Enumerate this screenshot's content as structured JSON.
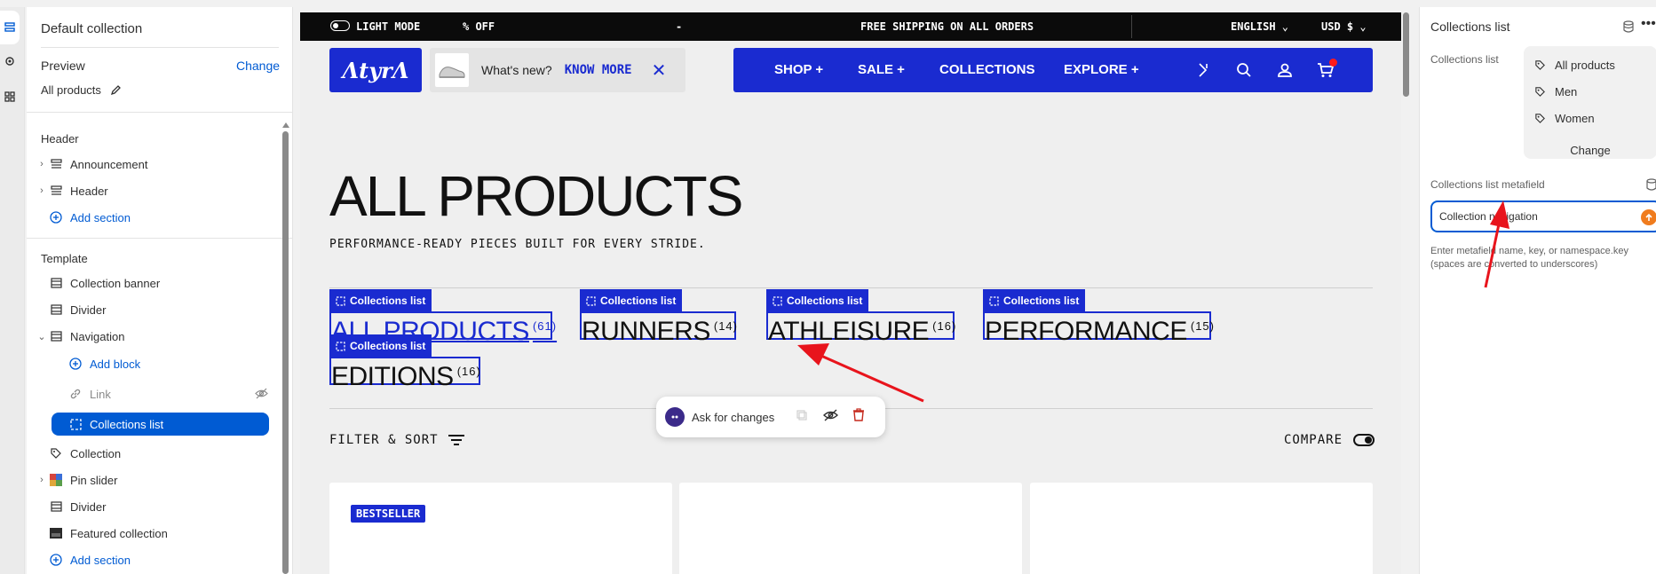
{
  "left_panel": {
    "title": "Default collection",
    "preview_label": "Preview",
    "preview_change": "Change",
    "preview_value": "All products",
    "header_label": "Header",
    "header_items": [
      "Announcement",
      "Header"
    ],
    "add_section": "Add section",
    "template_label": "Template",
    "template_items": {
      "collection_banner": "Collection banner",
      "divider_1": "Divider",
      "navigation": "Navigation",
      "add_block": "Add block",
      "link": "Link",
      "collections_list": "Collections list",
      "collection": "Collection",
      "pin_slider": "Pin slider",
      "divider_2": "Divider",
      "featured_collection": "Featured collection",
      "add_section": "Add section"
    }
  },
  "preview": {
    "topbar": {
      "light_mode": "LIGHT MODE",
      "off": "% OFF",
      "dash": "-",
      "shipping": "FREE SHIPPING ON ALL ORDERS",
      "language": "ENGLISH",
      "currency": "USD $"
    },
    "logo": "ɅtyrɅ",
    "promo": {
      "text": "What's new?",
      "link": "KNOW MORE"
    },
    "nav": {
      "shop": "SHOP +",
      "sale": "SALE +",
      "collections": "COLLECTIONS",
      "explore": "EXPLORE +"
    },
    "title": "ALL PRODUCTS",
    "subtitle": "PERFORMANCE-READY PIECES BUILT FOR EVERY STRIDE.",
    "tag_label": "Collections list",
    "collections": [
      {
        "name": "ALL PRODUCTS",
        "count": "(61)"
      },
      {
        "name": "RUNNERS",
        "count": "(14)"
      },
      {
        "name": "ATHLEISURE",
        "count": "(16)"
      },
      {
        "name": "PERFORMANCE",
        "count": "(15)"
      },
      {
        "name": "EDITIONS",
        "count": "(16)"
      }
    ],
    "ask_changes": "Ask for changes",
    "filter": "FILTER & SORT",
    "compare": "COMPARE",
    "badge": "BESTSELLER"
  },
  "right_panel": {
    "title": "Collections list",
    "list_label": "Collections list",
    "list_items": [
      "All products",
      "Men",
      "Women"
    ],
    "change": "Change",
    "metafield_label": "Collections list metafield",
    "metafield_value": "Collection navigation",
    "help_line1": "Enter metafield name, key, or namespace.key",
    "help_line2": "(spaces are converted to underscores)"
  },
  "colors": {
    "brand": "#1a2bd0",
    "admin_blue": "#005bd3",
    "annotation": "#e8141c"
  }
}
